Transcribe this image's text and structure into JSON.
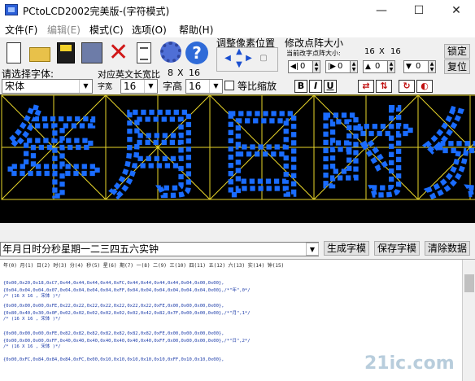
{
  "window": {
    "title": "PCtoLCD2002完美版-(字符模式)",
    "min": "—",
    "max": "☐",
    "close": "✕"
  },
  "menu": [
    {
      "label": "文件(F)",
      "disabled": false
    },
    {
      "label": "编辑(E)",
      "disabled": true
    },
    {
      "label": "模式(C)",
      "disabled": false
    },
    {
      "label": "选项(O)",
      "disabled": false
    },
    {
      "label": "帮助(H)",
      "disabled": false
    }
  ],
  "toolbar": {
    "icons": [
      "new-file-icon",
      "open-folder-icon",
      "save-icon",
      "save-as-icon",
      "delete-icon",
      "document-icon",
      "gear-icon",
      "help-icon"
    ],
    "help_glyph": "?",
    "delete_glyph": "✕"
  },
  "pixel_adjust": {
    "label": "调整像素位置"
  },
  "matrix_size": {
    "label": "修改点阵大小",
    "current_label": "当前改字点阵大小:",
    "current_w": "16",
    "x": "X",
    "current_h": "16",
    "lock": "锁定",
    "reset": "复位",
    "spins": [
      {
        "glyph": "◀|",
        "value": "0"
      },
      {
        "glyph": "|▶",
        "value": "0"
      },
      {
        "glyph": "▲",
        "value": "0"
      },
      {
        "glyph": "▼",
        "value": "0"
      }
    ]
  },
  "font_select": {
    "label": "请选择字体:",
    "value": "宋体"
  },
  "ascii": {
    "label": "对应英文长宽比",
    "w": "8",
    "x": "X",
    "h": "16"
  },
  "font_width": {
    "label": "字宽",
    "value": "16"
  },
  "font_height": {
    "label": "字高",
    "value": "16"
  },
  "proportional": {
    "label": "等比缩放"
  },
  "styles": {
    "bold": "B",
    "italic": "I",
    "underline": "U"
  },
  "canvas": {
    "glyph_count": 5,
    "grid_color": "#e8d62a",
    "pixel_color": "#1a6cff",
    "background": "#000000",
    "chars": [
      "年",
      "月",
      "日",
      "时",
      "分"
    ]
  },
  "input": {
    "value": "年月日时分秒星期一二三四五六实钟"
  },
  "buttons": {
    "generate": "生成字模",
    "save": "保存字模",
    "clear": "清除数据"
  },
  "output": {
    "index_line": "年(0) 月(1) 日(2) 时(3) 分(4) 秒(5) 星(6) 期(7) 一(8) 二(9) 三(10) 四(11) 五(12) 六(13) 实(14) 钟(15)",
    "lines": [
      "{0x00,0x20,0x18,0xC7,0x44,0x44,0x44,0x44,0xFC,0x44,0x44,0x44,0x44,0x04,0x00,0x00},",
      "{0x04,0x04,0x04,0x07,0x04,0x04,0x04,0x04,0xFF,0x04,0x04,0x04,0x04,0x04,0x04,0x00},/*\"年\",0*/",
      "/* (16 X 16 , 宋体 )*/",
      "",
      "{0x00,0x00,0x00,0xFE,0x22,0x22,0x22,0x22,0x22,0x22,0x22,0xFE,0x00,0x00,0x00,0x00},",
      "{0x80,0x40,0x30,0x0F,0x02,0x02,0x02,0x02,0x02,0x02,0x42,0x82,0x7F,0x00,0x00,0x00},/*\"月\",1*/",
      "/* (16 X 16 , 宋体 )*/",
      "",
      "{0x00,0x00,0x00,0xFE,0x82,0x82,0x82,0x82,0x82,0x82,0x82,0xFE,0x00,0x00,0x00,0x00},",
      "{0x00,0x00,0x00,0xFF,0x40,0x40,0x40,0x40,0x40,0x40,0x40,0xFF,0x00,0x00,0x00,0x00},/*\"日\",2*/",
      "/* (16 X 16 , 宋体 )*/",
      "",
      "{0x00,0xFC,0x84,0x84,0x84,0xFC,0x00,0x10,0x10,0x10,0x10,0x10,0xFF,0x10,0x10,0x00},"
    ]
  },
  "watermark": {
    "text": "21ic.com"
  }
}
